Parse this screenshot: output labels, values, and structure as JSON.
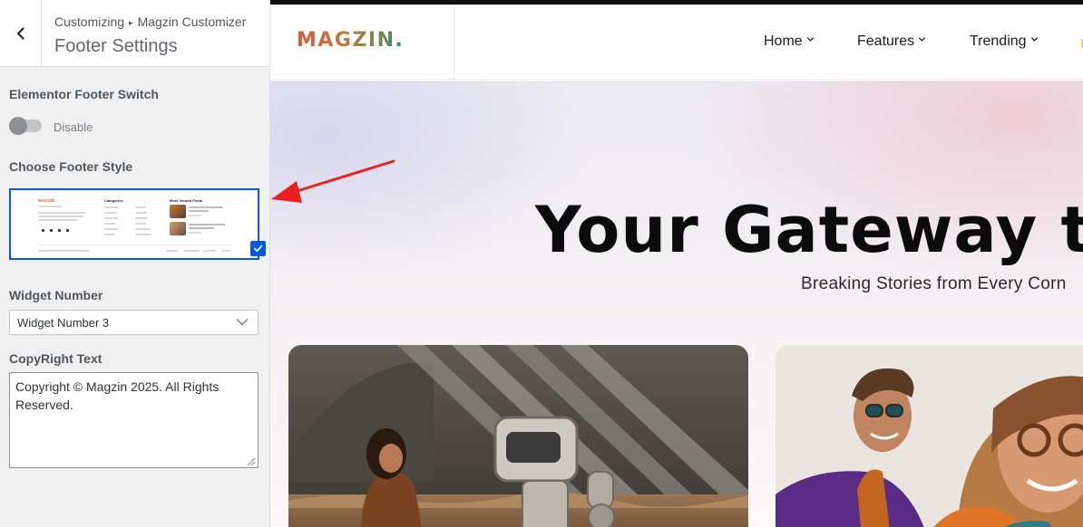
{
  "sidebar": {
    "breadcrumb_root": "Customizing",
    "breadcrumb_separator": "▸",
    "breadcrumb_section": "Magzin Customizer",
    "panel_title": "Footer Settings",
    "elementor_switch": {
      "label": "Elementor Footer Switch",
      "state_text": "Disable",
      "enabled": false
    },
    "footer_style": {
      "label": "Choose Footer Style",
      "selected": true,
      "thumbnail": {
        "logo": "MAGZIN.",
        "col2_title": "Categories",
        "col3_title": "Most Viewed Posts",
        "categories_a": [
          "Business.gg",
          "Country.gg",
          "Fashion.gg",
          "Food.gg",
          "Lifestyle.gg",
          "Music.gg"
        ],
        "categories_b": [
          "Craft.gg",
          "Design.gg",
          "Fitness.gg",
          "Gaming.gg",
          "Marketing.gg",
          "Technology.gg"
        ],
        "post1": "The Science of Happiness: What Actually Works",
        "post2": "Inside the Startup Boom: Young Entrepreneurs Making Waves",
        "copyright": "Copyright © Magzin 2025. All Rights Reserved.",
        "links": [
          "Privacy Policy",
          "Terms & Conditions",
          "Refund Policy",
          "Contact"
        ]
      }
    },
    "widget_number": {
      "label": "Widget Number",
      "value": "Widget Number 3"
    },
    "copyright": {
      "label": "CopyRight Text",
      "value": "Copyright © Magzin 2025. All Rights Reserved."
    }
  },
  "preview": {
    "logo": "MAGZIN.",
    "nav": [
      {
        "label": "Home"
      },
      {
        "label": "Features"
      },
      {
        "label": "Trending"
      }
    ],
    "hero_title": "Your Gateway to C",
    "hero_subtitle": "Breaking Stories from Every Corn"
  },
  "colors": {
    "accent": "#0a57d8",
    "annotation_arrow": "#e8211d",
    "logo_gradient": [
      "#e2533a",
      "#c37a3a",
      "#3f8a5f"
    ]
  },
  "icons": {
    "back": "chevron-left-icon",
    "select": "chevron-down-icon",
    "selected": "checkmark-icon"
  }
}
